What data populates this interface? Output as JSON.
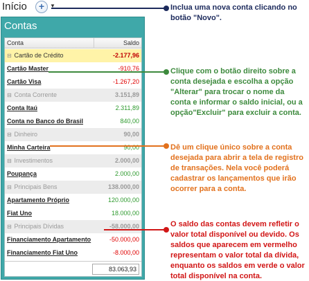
{
  "header": {
    "title": "Início",
    "add_symbol": "+",
    "caret": "▼"
  },
  "panel": {
    "title": "Contas",
    "columns": {
      "name": "Conta",
      "balance": "Saldo"
    },
    "total": "83.063,93"
  },
  "rows": [
    {
      "kind": "group",
      "label": "Cartão de Crédito",
      "value": "-2.177,96",
      "highlight": true
    },
    {
      "kind": "account",
      "label": "Cartão Master",
      "value": "-910,76",
      "sign": "neg"
    },
    {
      "kind": "account",
      "label": "Cartão Visa",
      "value": "-1.267,20",
      "sign": "neg"
    },
    {
      "kind": "group",
      "label": "Conta Corrente",
      "value": "3.151,89"
    },
    {
      "kind": "account",
      "label": "Conta Itaú",
      "value": "2.311,89",
      "sign": "pos"
    },
    {
      "kind": "account",
      "label": "Conta no Banco do Brasil",
      "value": "840,00",
      "sign": "pos"
    },
    {
      "kind": "group",
      "label": "Dinheiro",
      "value": "90,00"
    },
    {
      "kind": "account",
      "label": "Minha Carteira",
      "value": "90,00",
      "sign": "pos"
    },
    {
      "kind": "group",
      "label": "Investimentos",
      "value": "2.000,00"
    },
    {
      "kind": "account",
      "label": "Poupança",
      "value": "2.000,00",
      "sign": "pos"
    },
    {
      "kind": "group",
      "label": "Principais Bens",
      "value": "138.000,00"
    },
    {
      "kind": "account",
      "label": "Apartamento Próprio",
      "value": "120.000,00",
      "sign": "pos"
    },
    {
      "kind": "account",
      "label": "Fiat Uno",
      "value": "18.000,00",
      "sign": "pos"
    },
    {
      "kind": "group",
      "label": "Principais Dívidas",
      "value": "-58.000,00"
    },
    {
      "kind": "account",
      "label": "Financiamento Apartamento",
      "value": "-50.000,00",
      "sign": "neg"
    },
    {
      "kind": "account",
      "label": "Financiamento Fiat Uno",
      "value": "-8.000,00",
      "sign": "neg"
    }
  ],
  "callouts": {
    "novo": "Inclua uma nova conta clicando no botão \"Novo\".",
    "alterar": "Clique com o botão direito sobre a conta desejada e escolha a opção \"Alterar\" para trocar o nome da conta e informar o saldo inicial, ou a opção\"Excluir\" para excluir a conta.",
    "registro": "Dê um clique único sobre a conta desejada para abrir a tela de registro de transações. Nela você poderá cadastrar os lançamentos que irão ocorrer para a conta.",
    "saldo": "O saldo das contas devem refletir o valor total disponível ou devido. Os saldos que aparecem em vermelho representam o valor total da dívida, enquanto os saldos em verde o valor total disponível na conta."
  },
  "colors": {
    "panel": "#3fa8a9",
    "callout_novo": "#1c2a5c",
    "callout_alterar": "#3d8a3d",
    "callout_registro": "#e2711d",
    "callout_saldo": "#d11616",
    "negative": "#e00000",
    "positive": "#2e9a2e"
  },
  "icons": {
    "add": "plus-circle-icon",
    "toggle": "minus-square-icon"
  }
}
